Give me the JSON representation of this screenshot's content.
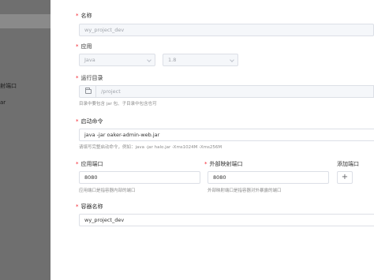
{
  "background": {
    "line1": "射端口",
    "line2": "ar"
  },
  "form": {
    "name": {
      "label": "名称",
      "value": "wy_project_dev"
    },
    "app": {
      "label": "应用",
      "app_value": "Java",
      "version_value": "1.8"
    },
    "workdir": {
      "label": "运行目录",
      "value": "/project",
      "help": "目录中要包含 jar 包、子目录中包含也可"
    },
    "command": {
      "label": "启动命令",
      "value": "java -jar oaker-admin-web.jar",
      "help": "请填写完整启动命令，例如：java -jar halo.jar -Xms1024M -Xms256M"
    },
    "app_port": {
      "label": "应用端口",
      "value": "8080",
      "help": "应用端口是指容器内部的端口"
    },
    "ext_port": {
      "label": "外部映射端口",
      "value": "8080",
      "help": "外部映射端口是指容器对外暴露的端口"
    },
    "add_port": {
      "label": "添加端口",
      "button": "+"
    },
    "container": {
      "label": "容器名称",
      "value": "wy_project_dev"
    }
  }
}
